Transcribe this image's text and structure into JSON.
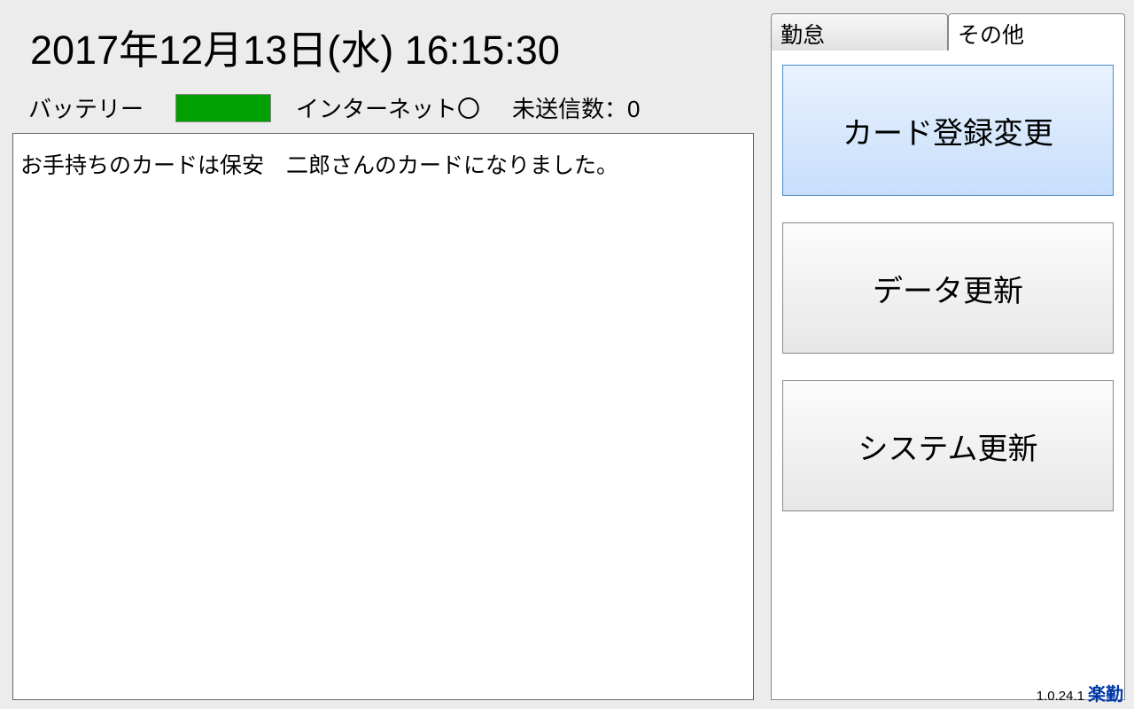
{
  "header": {
    "datetime": "2017年12月13日(水) 16:15:30"
  },
  "status": {
    "battery_label": "バッテリー",
    "internet_label": "インターネット〇",
    "unsent_label": "未送信数：0",
    "battery_color": "#00a000"
  },
  "message": {
    "text": "お手持ちのカードは保安　二郎さんのカードになりました。"
  },
  "tabs": {
    "attendance": "勤怠",
    "other": "その他"
  },
  "buttons": {
    "card_register": "カード登録変更",
    "data_update": "データ更新",
    "system_update": "システム更新"
  },
  "footer": {
    "version": "1.0.24.1",
    "logo": "楽勤"
  }
}
